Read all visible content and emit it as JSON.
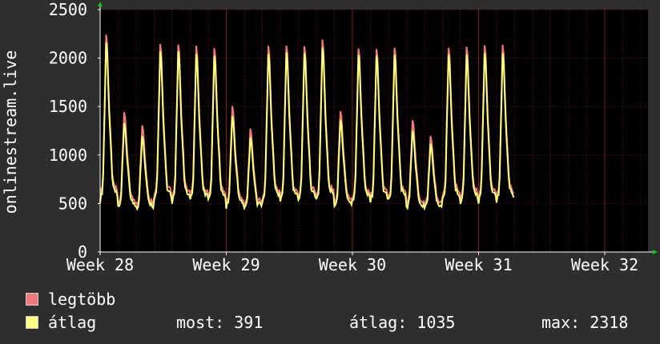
{
  "chart_data": {
    "type": "line",
    "ylabel": "onlinestream.live",
    "ylim": [
      0,
      2500
    ],
    "yticks": [
      0,
      500,
      1000,
      1500,
      2000,
      2500
    ],
    "xticks": [
      "Week 28",
      "Week 29",
      "Week 30",
      "Week 31",
      "Week 32"
    ],
    "grid": true,
    "colors": {
      "background": "#2e2e2e",
      "plot_bg": "#000000",
      "grid": "#5a1818",
      "max": "#f47a7a",
      "avg": "#ffff80",
      "axis_arrow": "#00cc00"
    },
    "days_max": [
      2350,
      1480,
      1340,
      2260,
      2250,
      2220,
      2210,
      1550,
      1300,
      2230,
      2240,
      2230,
      2290,
      1510,
      2200,
      2190,
      2210,
      1400,
      1220,
      2210,
      2210,
      2230,
      2230
    ],
    "days_avg": [
      2300,
      1400,
      1260,
      2200,
      2200,
      2170,
      2150,
      1480,
      1240,
      2170,
      2190,
      2180,
      2240,
      1440,
      2160,
      2150,
      2160,
      1320,
      1170,
      2160,
      2160,
      2180,
      2180
    ],
    "series": [
      {
        "name": "legtöbb"
      },
      {
        "name": "átlag"
      }
    ]
  },
  "legend": {
    "max_label": "legtöbb",
    "avg_label": "átlag"
  },
  "stats": {
    "most": "most: 391",
    "avg": "átlag: 1035",
    "max": "max: 2318"
  }
}
